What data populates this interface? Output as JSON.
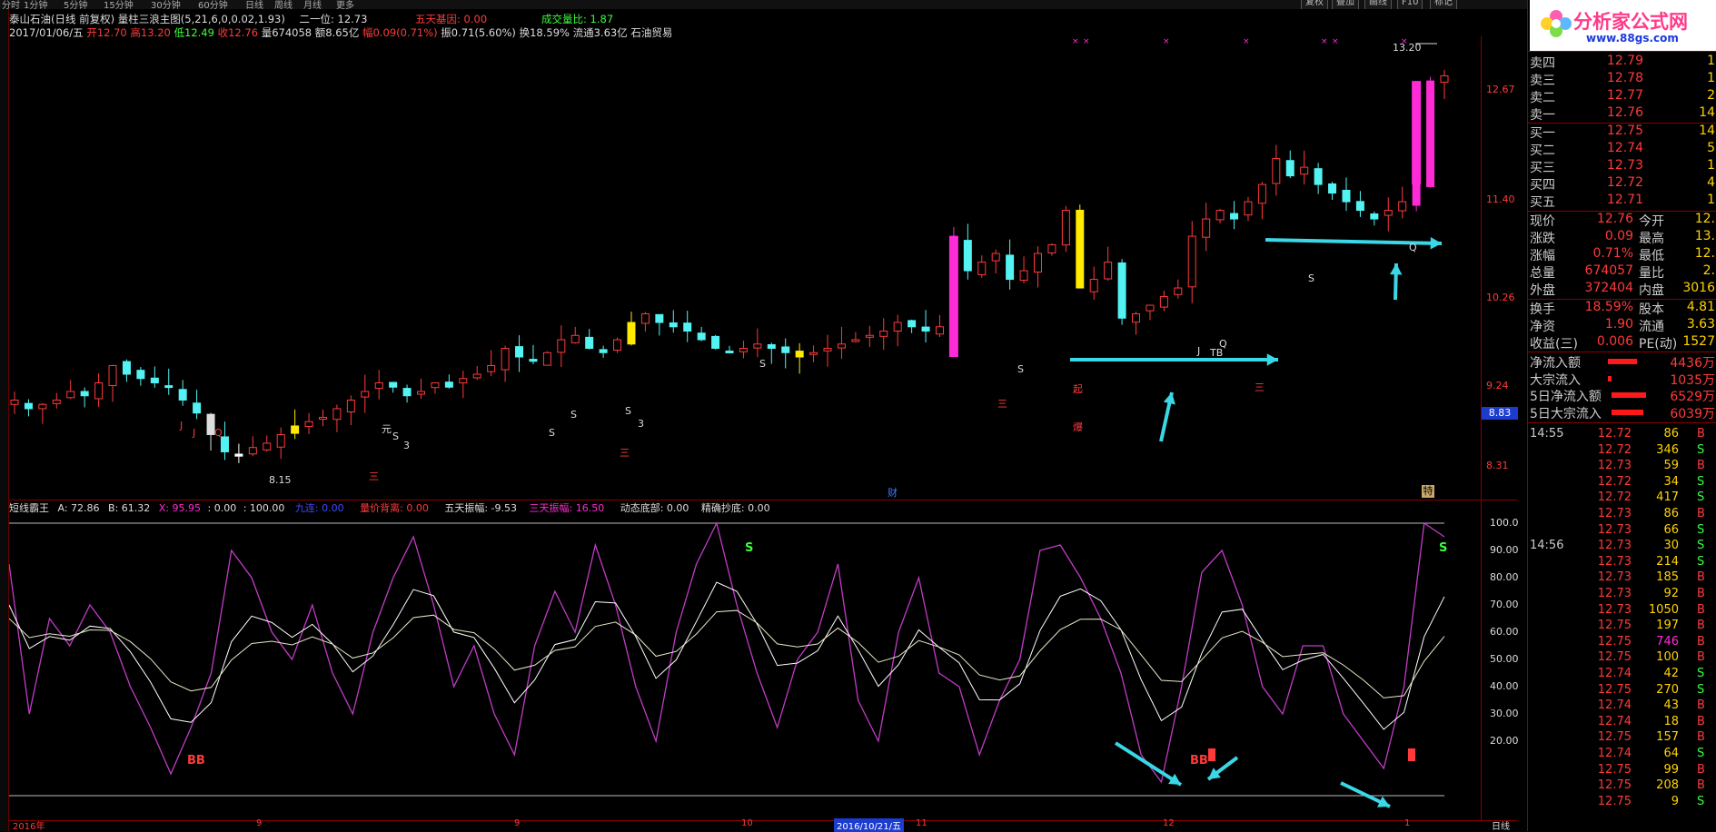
{
  "menu": {
    "tabs": [
      "分时",
      "1分钟",
      "5分钟",
      "15分钟",
      "30分钟",
      "60分钟",
      "日线",
      "周线",
      "月线",
      "更多"
    ],
    "buttons": [
      "复权",
      "叠加",
      "画线",
      "F10",
      "标记"
    ]
  },
  "header": {
    "title_line": "泰山石油(日线 前复权) 量柱三浪主图(5,21,6,0,0.02,1.93)",
    "second_pos": "二一位: 12.73",
    "wutian_label": "五天基因: 0.00",
    "volratio_label": "成交量比: 1.87",
    "date": "2017/01/06/五",
    "open": "开12.70",
    "high": "高13.20",
    "low": "低12.49",
    "close": "收12.76",
    "vol": "量674058",
    "amount": "额8.65亿",
    "change": "幅0.09(0.71%)",
    "amplitude": "振0.71(5.60%)",
    "turnover": "换18.59%",
    "float": "流通3.63亿",
    "industry": "石油贸易"
  },
  "main_chart": {
    "price_ticks": [
      "12.67",
      "11.40",
      "10.26",
      "9.24",
      "8.31"
    ],
    "current_price_tag": "8.83",
    "low_label": "8.15",
    "high_label": "13.20",
    "event_cai": "财",
    "event_right": "特",
    "marks": [
      "J",
      "J",
      "Q",
      "元",
      "S",
      "3",
      "三",
      "S",
      "3",
      "S",
      "S",
      "三",
      "S",
      "S",
      "三",
      "起",
      "爆",
      "J",
      "TB",
      "Q",
      "三",
      "S",
      "Q"
    ]
  },
  "indicator": {
    "name": "短线霸王",
    "a_label": "A: 72.86",
    "b_label": "B: 61.32",
    "x_label": "X: 95.95",
    "c_label": ": 0.00",
    "d_label": ": 100.00",
    "jiu_label": "九连: 0.00",
    "lj_label": "量价背离: 0.00",
    "wu_label": "五天振幅: -9.53",
    "san_label": "三天振幅: 16.50",
    "dong_label": "动态底部: 0.00",
    "jq_label": "精确抄底: 0.00",
    "y_ticks": [
      "100.0",
      "90.00",
      "80.00",
      "70.00",
      "60.00",
      "50.00",
      "40.00",
      "30.00",
      "20.00"
    ],
    "marks": [
      "S",
      "S",
      "BB",
      "BB"
    ]
  },
  "bottom_axis": {
    "labels": [
      "2016年",
      "9",
      "9",
      "10",
      "2016/10/21/五",
      "11",
      "12",
      "1"
    ],
    "right": "日线"
  },
  "right_panel": {
    "logo_text": "分析家公式网",
    "logo_url": "www.88gs.com",
    "asks": [
      {
        "label": "卖四",
        "price": "12.79",
        "vol": "1"
      },
      {
        "label": "卖三",
        "price": "12.78",
        "vol": "1"
      },
      {
        "label": "卖二",
        "price": "12.77",
        "vol": "2"
      },
      {
        "label": "卖一",
        "price": "12.76",
        "vol": "14"
      }
    ],
    "bids": [
      {
        "label": "买一",
        "price": "12.75",
        "vol": "14"
      },
      {
        "label": "买二",
        "price": "12.74",
        "vol": "5"
      },
      {
        "label": "买三",
        "price": "12.73",
        "vol": "1"
      },
      {
        "label": "买四",
        "price": "12.72",
        "vol": "4"
      },
      {
        "label": "买五",
        "price": "12.71",
        "vol": "1"
      }
    ],
    "stats": [
      {
        "l1": "现价",
        "v1": "12.76",
        "l2": "今开",
        "v2": "12."
      },
      {
        "l1": "涨跌",
        "v1": "0.09",
        "l2": "最高",
        "v2": "13."
      },
      {
        "l1": "涨幅",
        "v1": "0.71%",
        "l2": "最低",
        "v2": "12."
      },
      {
        "l1": "总量",
        "v1": "674057",
        "l2": "量比",
        "v2": "2."
      },
      {
        "l1": "外盘",
        "v1": "372404",
        "l2": "内盘",
        "v2": "3016"
      }
    ],
    "stats2": [
      {
        "l1": "换手",
        "v1": "18.59%",
        "l2": "股本",
        "v2": "4.81"
      },
      {
        "l1": "净资",
        "v1": "1.90",
        "l2": "流通",
        "v2": "3.63"
      },
      {
        "l1": "收益(三)",
        "v1": "0.006",
        "l2": "PE(动)",
        "v2": "1527"
      }
    ],
    "flows": [
      {
        "label": "净流入额",
        "value": "4436万",
        "bar": 0.5
      },
      {
        "label": "大宗流入",
        "value": "1035万",
        "bar": 0.07
      },
      {
        "label": "5日净流入额",
        "value": "6529万",
        "bar": 0.6
      },
      {
        "label": "5日大宗流入",
        "value": "6039万",
        "bar": 0.55
      }
    ],
    "ticks": [
      {
        "t": "14:55",
        "p": "12.72",
        "q": "86",
        "d": "B"
      },
      {
        "t": "",
        "p": "12.72",
        "q": "346",
        "d": "S"
      },
      {
        "t": "",
        "p": "12.73",
        "q": "59",
        "d": "B"
      },
      {
        "t": "",
        "p": "12.72",
        "q": "34",
        "d": "S"
      },
      {
        "t": "",
        "p": "12.72",
        "q": "417",
        "d": "S"
      },
      {
        "t": "",
        "p": "12.73",
        "q": "86",
        "d": "B"
      },
      {
        "t": "",
        "p": "12.73",
        "q": "66",
        "d": "S"
      },
      {
        "t": "14:56",
        "p": "12.73",
        "q": "30",
        "d": "S"
      },
      {
        "t": "",
        "p": "12.73",
        "q": "214",
        "d": "S"
      },
      {
        "t": "",
        "p": "12.73",
        "q": "185",
        "d": "B"
      },
      {
        "t": "",
        "p": "12.73",
        "q": "92",
        "d": "B"
      },
      {
        "t": "",
        "p": "12.73",
        "q": "1050",
        "d": "B"
      },
      {
        "t": "",
        "p": "12.75",
        "q": "197",
        "d": "B"
      },
      {
        "t": "",
        "p": "12.75",
        "q": "746",
        "d": "B"
      },
      {
        "t": "",
        "p": "12.75",
        "q": "100",
        "d": "B"
      },
      {
        "t": "",
        "p": "12.74",
        "q": "42",
        "d": "S"
      },
      {
        "t": "",
        "p": "12.75",
        "q": "270",
        "d": "S"
      },
      {
        "t": "",
        "p": "12.74",
        "q": "43",
        "d": "B"
      },
      {
        "t": "",
        "p": "12.74",
        "q": "18",
        "d": "B"
      },
      {
        "t": "",
        "p": "12.75",
        "q": "157",
        "d": "B"
      },
      {
        "t": "",
        "p": "12.74",
        "q": "64",
        "d": "S"
      },
      {
        "t": "",
        "p": "12.75",
        "q": "99",
        "d": "B"
      },
      {
        "t": "",
        "p": "12.75",
        "q": "208",
        "d": "B"
      },
      {
        "t": "",
        "p": "12.75",
        "q": "9",
        "d": "S"
      }
    ]
  },
  "colors": {
    "up": "#ff3a3a",
    "down": "#54f3f3",
    "magenta": "#ff2bd6",
    "yellow": "#ffea00",
    "white": "#ffffff",
    "grid_red": "#8a0000"
  }
}
